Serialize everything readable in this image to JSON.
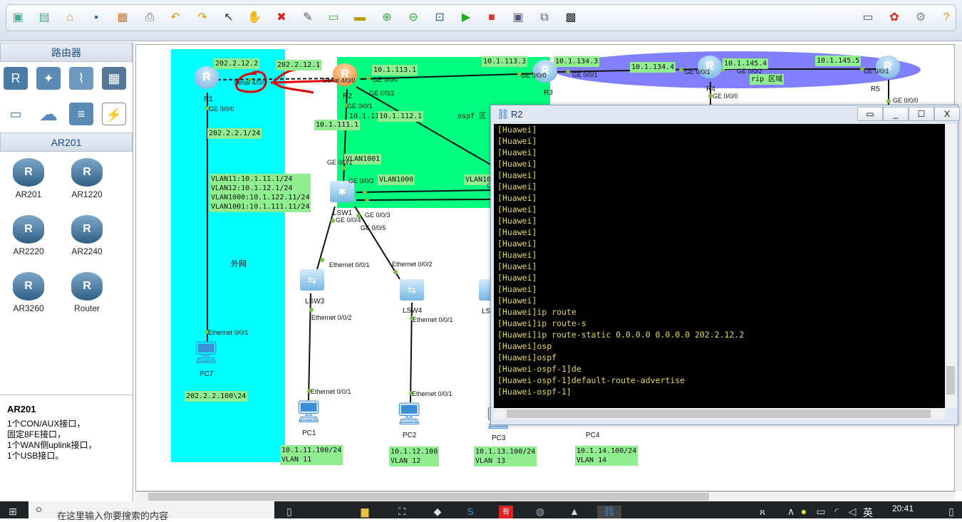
{
  "toolbar": {
    "icons": [
      "new-topology",
      "new-file",
      "open",
      "save",
      "save-as",
      "print",
      "undo",
      "redo",
      "select",
      "hand-pan",
      "delete",
      "delete-link",
      "text-annotation",
      "rectangle",
      "zoom-in",
      "zoom-out",
      "fit-view",
      "start-device",
      "stop-device",
      "capture",
      "topology",
      "console"
    ],
    "right_icons": [
      "chat",
      "huawei-logo",
      "settings",
      "help"
    ]
  },
  "left_panel": {
    "category_title": "路由器",
    "category_icons": [
      "router",
      "wireless-router",
      "wlan",
      "firewall",
      "pc",
      "cloud",
      "switch",
      "power"
    ],
    "device_header": "AR201",
    "devices": [
      {
        "label": "AR201"
      },
      {
        "label": "AR1220"
      },
      {
        "label": "AR2220"
      },
      {
        "label": "AR2240"
      },
      {
        "label": "AR3260"
      },
      {
        "label": "Router"
      }
    ],
    "description": {
      "title": "AR201",
      "lines": [
        "1个CON/AUX接口，",
        "固定8FE接口，",
        "1个WAN侧uplink接口，",
        "1个USB接口。"
      ]
    }
  },
  "topology": {
    "area_labels": {
      "external": "外网",
      "ospf": "ospf 区",
      "rip": "rip 区域"
    },
    "colors": {
      "external": "#00ffff",
      "ospf": "#00ff7f",
      "rip": "#8080ff",
      "label_bg": "#90ee90",
      "annotation": "#e00000"
    },
    "devices": {
      "r1": "R1",
      "r2": "R2",
      "r3": "R3",
      "r4": "R4",
      "r5": "R5",
      "lsw1": "LSW1",
      "lsw3": "LSW3",
      "lsw4": "LSW4",
      "lsw5": "LS",
      "pc1": "PC1",
      "pc2": "PC2",
      "pc3": "PC3",
      "pc4": "PC4",
      "pc7": "PC7"
    },
    "ip_labels": {
      "r1_serial": "202.2.12.2",
      "r2_serial": "202.2.12.1",
      "r1_ge": "202.2.2.1/24",
      "r2_r3": "10.1.113.1",
      "r3_r2": "10.1.113.3",
      "r3_r4": "10.1.134.3",
      "r4_r3": "10.1.134.4",
      "r4_r5": "10.1.145.4",
      "r5_r4": "10.1.145.5",
      "r2_lsw1": "10.1.111.1",
      "r2_ge2": "10.1.112.1",
      "vlan1001": "VLAN1001",
      "vlan1000": "VLAN1000",
      "vlan10x": "VLAN10",
      "lsw1_vlans": "VLAN11:10.1.11.1/24\nVLAN12:10.1.12.1/24\nVLAN1000:10.1.122.11/24\nVLAN1001:10.1.111.11/24",
      "pc7": "202.2.2.100\\24",
      "pc1": "10.1.11.100/24\nVLAN 11",
      "pc2": "10.1.12.100\nVLAN 12",
      "pc3": "10.1.13.100/24\nVLAN 13",
      "pc4": "10.1.14.100/24\nVLAN 14"
    },
    "ports": {
      "serial_r1": "Serial 4/0/0",
      "serial_r2": "Serial 4/0/0",
      "ge000": "GE 0/0/0",
      "ge001": "GE 0/0/1",
      "ge002": "GE 0/0/2",
      "ge003": "GE 0/0/3",
      "ge004": "GE 0/0/4",
      "ge005": "GE 0/0/5",
      "eth001": "Ethernet 0/0/1",
      "eth002": "Ethernet 0/0/2",
      "g": "G"
    }
  },
  "terminal": {
    "title": "R2",
    "buttons": {
      "restore": "▭",
      "minimize": "_",
      "maximize": "☐",
      "close": "X"
    },
    "lines": [
      "[Huawei]",
      "[Huawei]",
      "[Huawei]",
      "[Huawei]",
      "[Huawei]",
      "[Huawei]",
      "[Huawei]",
      "[Huawei]",
      "[Huawei]",
      "[Huawei]",
      "[Huawei]",
      "[Huawei]",
      "[Huawei]",
      "[Huawei]",
      "[Huawei]",
      "[Huawei]",
      "[Huawei]ip route",
      "[Huawei]ip route-s",
      "[Huawei]ip route-static 0.0.0.0 0.0.0.0 202.2.12.2",
      "[Huawei]osp",
      "[Huawei]ospf",
      "[Huawei-ospf-1]de",
      "[Huawei-ospf-1]default-route-advertise",
      "[Huawei-ospf-1]"
    ]
  },
  "taskbar": {
    "search_placeholder": "在这里输入你要搜索的内容",
    "time": "20:41",
    "ime": "英",
    "apps": [
      "file-explorer",
      "store",
      "app",
      "browser-360",
      "youdao",
      "network",
      "photos",
      "ensp"
    ]
  }
}
